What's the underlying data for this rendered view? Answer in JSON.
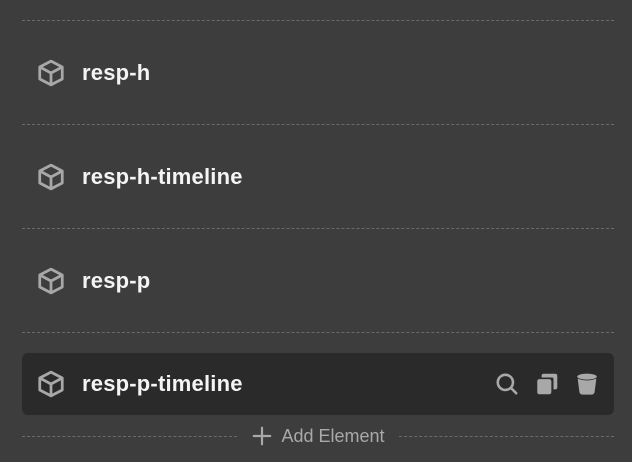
{
  "elements": [
    {
      "label": "resp-h",
      "icon": "cube-icon"
    },
    {
      "label": "resp-h-timeline",
      "icon": "cube-icon"
    },
    {
      "label": "resp-p",
      "icon": "cube-icon"
    },
    {
      "label": "resp-p-timeline",
      "icon": "cube-icon",
      "active": true
    }
  ],
  "row_actions": {
    "icons": [
      "search-icon",
      "duplicate-icon",
      "trash-icon"
    ]
  },
  "add_element": {
    "label": "Add Element",
    "icon": "plus-icon"
  },
  "colors": {
    "background": "#3d3d3d",
    "active_row": "#2a2a2a",
    "text": "#f4f4f4",
    "icon": "#a8a8a8",
    "muted_text": "#a9a9a9",
    "divider": "#6a6a6a"
  }
}
